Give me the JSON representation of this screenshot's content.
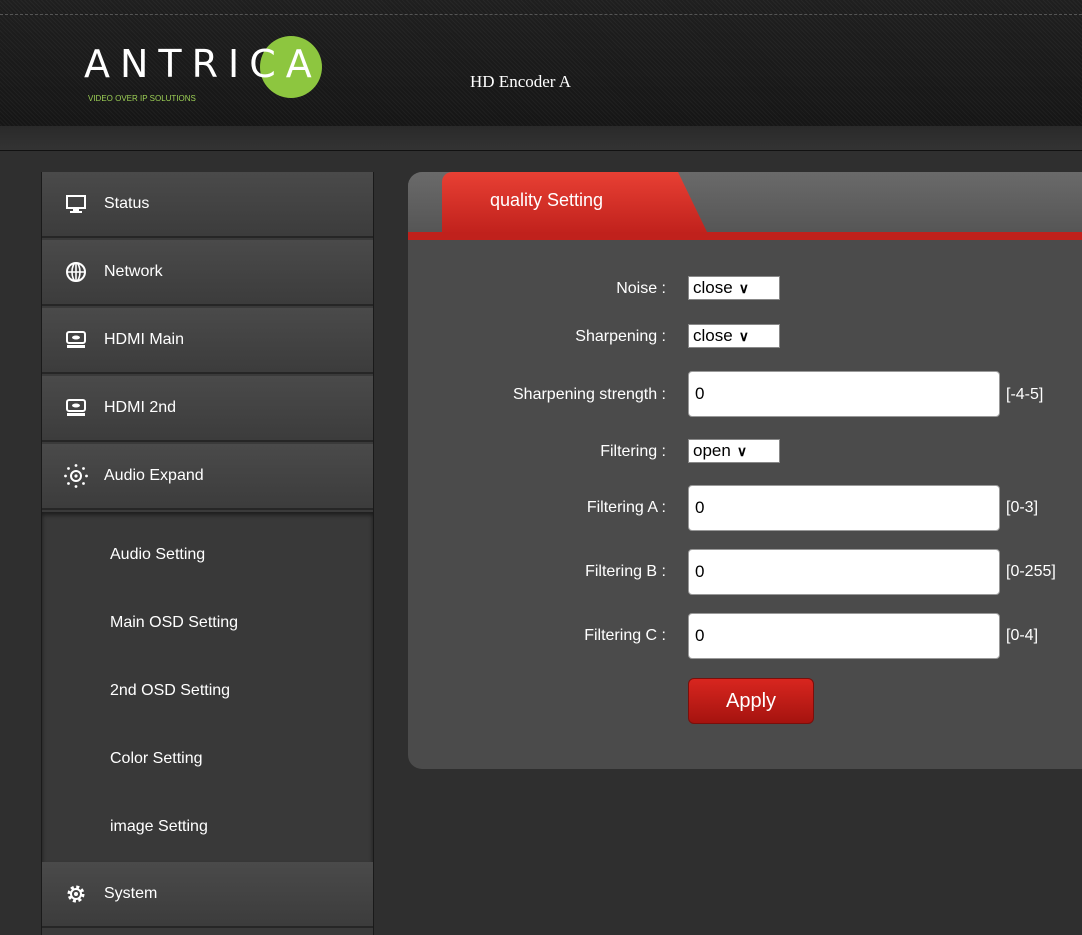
{
  "header": {
    "logo_text": "ANTRICA",
    "logo_tagline": "VIDEO OVER IP SOLUTIONS",
    "device_title": "HD Encoder  A"
  },
  "sidebar": {
    "items": [
      {
        "label": "Status",
        "icon": "monitor-icon"
      },
      {
        "label": "Network",
        "icon": "globe-icon"
      },
      {
        "label": "HDMI Main",
        "icon": "hdmi-icon"
      },
      {
        "label": "HDMI 2nd",
        "icon": "hdmi-icon"
      },
      {
        "label": "Audio Expand",
        "icon": "sun-dots-icon"
      }
    ],
    "sub_items": [
      "Audio Setting",
      "Main OSD Setting",
      "2nd OSD Setting",
      "Color Setting",
      "image Setting"
    ],
    "system": {
      "label": "System",
      "icon": "gear-icon"
    }
  },
  "panel": {
    "tab_label": "quality Setting",
    "noise": {
      "label": "Noise :",
      "value": "close"
    },
    "sharpening": {
      "label": "Sharpening :",
      "value": "close"
    },
    "sharpening_strength": {
      "label": "Sharpening strength :",
      "value": "0",
      "range": "[-4-5]"
    },
    "filtering": {
      "label": "Filtering :",
      "value": "open"
    },
    "filtering_a": {
      "label": "Filtering A :",
      "value": "0",
      "range": "[0-3]"
    },
    "filtering_b": {
      "label": "Filtering B :",
      "value": "0",
      "range": "[0-255]"
    },
    "filtering_c": {
      "label": "Filtering C :",
      "value": "0",
      "range": "[0-4]"
    },
    "apply_label": "Apply"
  },
  "colors": {
    "accent_red": "#c0211c",
    "logo_green": "#8dc63f",
    "background": "#2f2f2f"
  }
}
